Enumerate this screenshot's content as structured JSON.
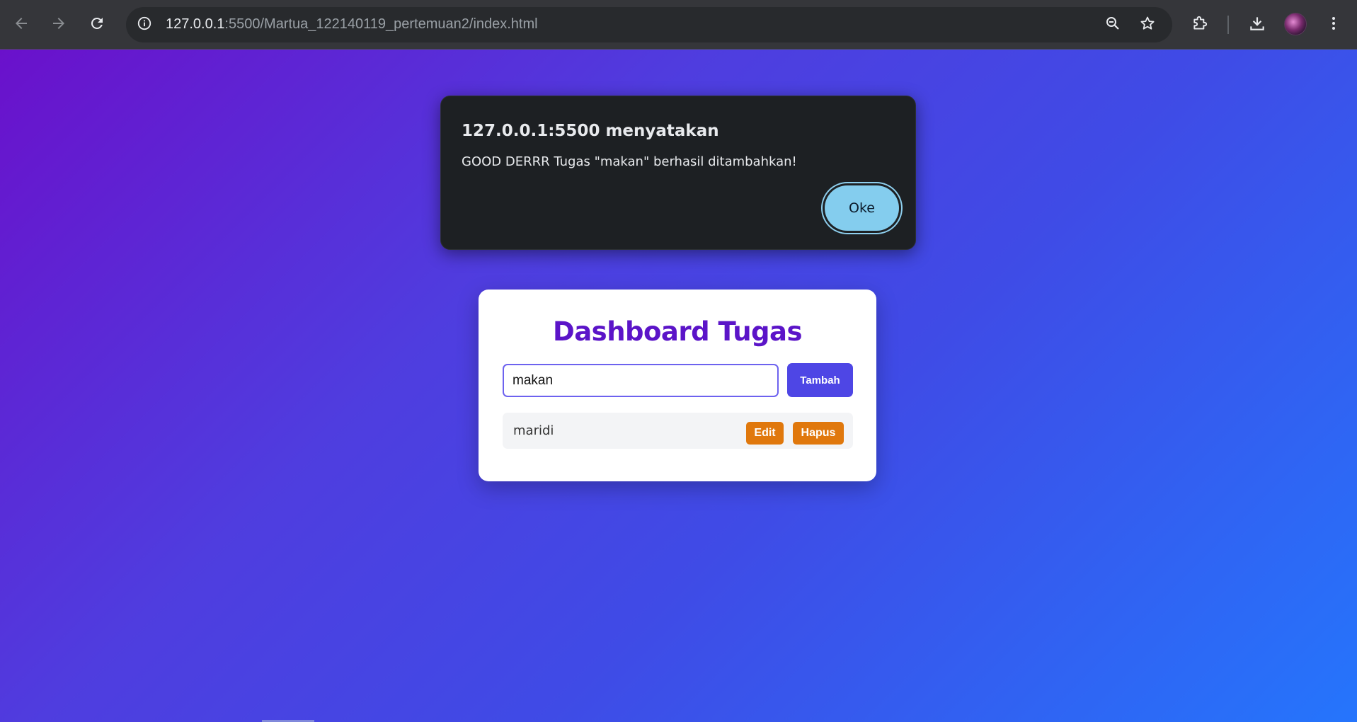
{
  "browser": {
    "url_host": "127.0.0.1",
    "url_rest": ":5500/Martua_122140119_pertemuan2/index.html"
  },
  "dialog": {
    "title": "127.0.0.1:5500 menyatakan",
    "message": "GOOD DERRR Tugas \"makan\" berhasil ditambahkan!",
    "ok_label": "Oke"
  },
  "dashboard": {
    "title": "Dashboard Tugas",
    "input_value": "makan",
    "add_label": "Tambah",
    "tasks": [
      {
        "text": "maridi",
        "edit_label": "Edit",
        "delete_label": "Hapus"
      }
    ]
  },
  "colors": {
    "gradient_start": "#6a11cb",
    "gradient_end": "#2575fc",
    "title_color": "#5b14c8",
    "add_button": "#4e46e5",
    "task_button": "#e0780d",
    "dialog_bg": "#1d2023",
    "ok_button": "#84cdee"
  },
  "icons": {
    "back": "arrow-left-icon",
    "forward": "arrow-right-icon",
    "reload": "reload-icon",
    "site_info": "info-icon",
    "zoom": "zoom-out-icon",
    "bookmark": "star-icon",
    "extensions": "puzzle-icon",
    "downloads": "download-icon",
    "menu": "kebab-menu-icon"
  }
}
